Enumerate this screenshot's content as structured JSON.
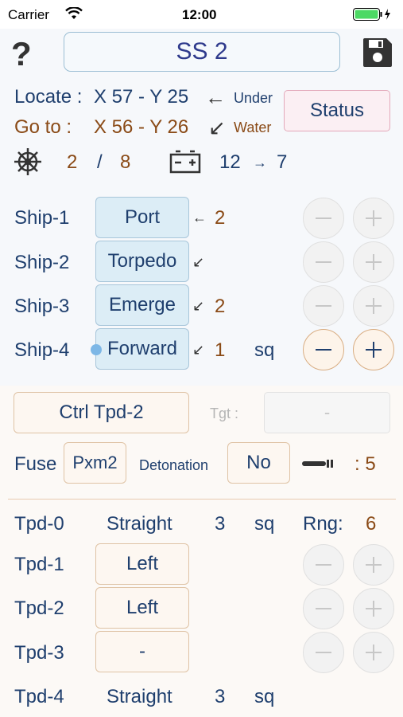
{
  "statusbar": {
    "carrier": "Carrier",
    "time": "12:00"
  },
  "header": {
    "help": "?",
    "title": "SS 2"
  },
  "locate": {
    "label": "Locate :",
    "coords": "X 57 - Y 25",
    "arrow": "←",
    "mode": "Under"
  },
  "goto": {
    "label": "Go to :",
    "coords": "X 56 - Y 26",
    "arrow": "↙",
    "mode": "Water"
  },
  "status_button": "Status",
  "stats": {
    "crew": "2",
    "sep": "/",
    "crew_max": "8",
    "battery_from": "12",
    "battery_arrow": "→",
    "battery_to": "7"
  },
  "ships": [
    {
      "name": "Ship-1",
      "order": "Port",
      "arrow": "←",
      "value": "2",
      "unit": "",
      "active": false
    },
    {
      "name": "Ship-2",
      "order": "Torpedo",
      "arrow": "↙",
      "value": "",
      "unit": "",
      "active": false
    },
    {
      "name": "Ship-3",
      "order": "Emerge",
      "arrow": "↙",
      "value": "2",
      "unit": "",
      "active": false
    },
    {
      "name": "Ship-4",
      "order": "Forward",
      "arrow": "↙",
      "value": "1",
      "unit": "sq",
      "active": true
    }
  ],
  "ctrl": {
    "button": "Ctrl Tpd-2",
    "tgt_label": "Tgt :",
    "tgt_value": "-"
  },
  "fuse": {
    "label": "Fuse",
    "value": "Pxm2",
    "det_label": "Detonation",
    "det_value": "No",
    "count": ": 5"
  },
  "tpd0": {
    "name": "Tpd-0",
    "course": "Straight",
    "dist": "3",
    "unit": "sq",
    "rng_label": "Rng:",
    "rng_value": "6"
  },
  "tpds": [
    {
      "name": "Tpd-1",
      "course": "Left"
    },
    {
      "name": "Tpd-2",
      "course": "Left"
    },
    {
      "name": "Tpd-3",
      "course": "-"
    }
  ],
  "tpd4": {
    "name": "Tpd-4",
    "course": "Straight",
    "dist": "3",
    "unit": "sq"
  },
  "colors": {
    "navy": "#1f3f6e",
    "brown": "#8a4a16",
    "blue_button": "#dcedf6",
    "tan_button": "#fdf7f1",
    "battery_green": "#4cd964"
  }
}
